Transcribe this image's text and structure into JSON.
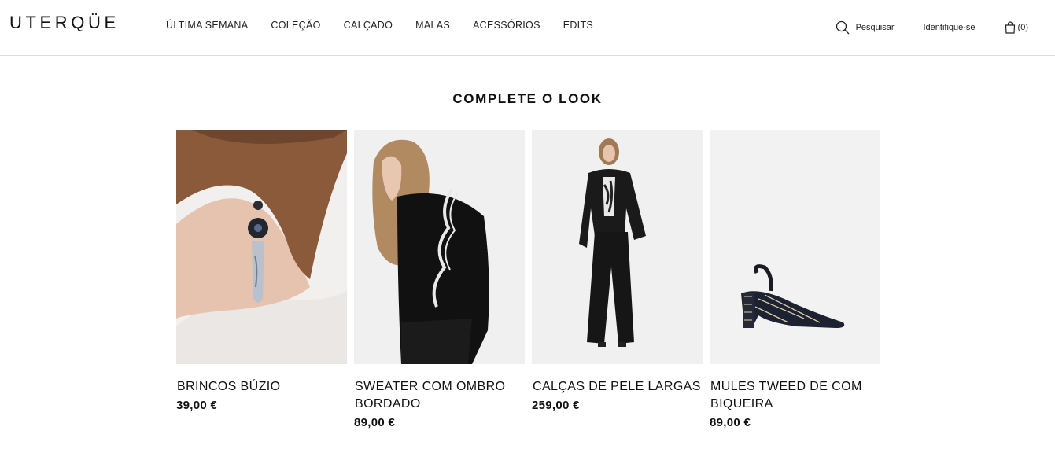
{
  "brand": {
    "logo": "UTERQÜE"
  },
  "nav": {
    "items": [
      {
        "label": "ÚLTIMA SEMANA"
      },
      {
        "label": "COLEÇÃO"
      },
      {
        "label": "CALÇADO"
      },
      {
        "label": "MALAS"
      },
      {
        "label": "ACESSÓRIOS"
      },
      {
        "label": "EDITS"
      }
    ]
  },
  "tools": {
    "search_label": "Pesquisar",
    "login_label": "Identifique-se",
    "cart_label": "(0)"
  },
  "section": {
    "title": "COMPLETE O LOOK",
    "products": [
      {
        "name": "BRINCOS BÚZIO",
        "price": "39,00 €",
        "image": "earring-model-photo"
      },
      {
        "name": "SWEATER COM OMBRO BORDADO",
        "price": "89,00 €",
        "image": "sweater-model-photo"
      },
      {
        "name": "CALÇAS DE PELE LARGAS",
        "price": "259,00 €",
        "image": "leather-trousers-model-photo"
      },
      {
        "name": "MULES TWEED DE COM BIQUEIRA",
        "price": "89,00 €",
        "image": "tweed-mule-shoe-photo"
      }
    ]
  },
  "colors": {
    "text": "#111111",
    "divider": "#dcdcdc",
    "photo_bg": "#efefef"
  }
}
